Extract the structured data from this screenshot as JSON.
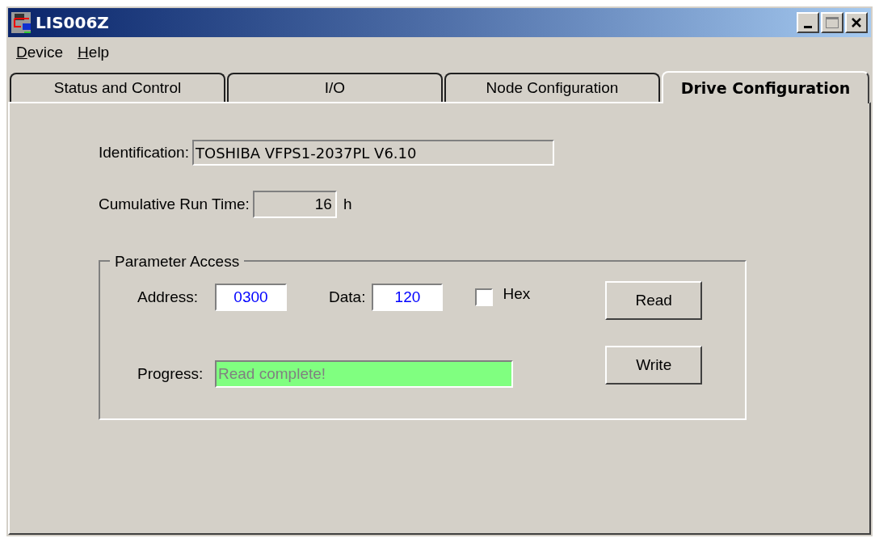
{
  "window": {
    "title": "LIS006Z"
  },
  "menu": [
    {
      "label": "Device"
    },
    {
      "label": "Help"
    }
  ],
  "tabs": [
    {
      "label": "Status and Control",
      "selected": false
    },
    {
      "label": "I/O",
      "selected": false
    },
    {
      "label": "Node Configuration",
      "selected": false
    },
    {
      "label": "Drive Configuration",
      "selected": true
    }
  ],
  "identification": {
    "label": "Identification:",
    "value": "TOSHIBA VFPS1-2037PL V6.10"
  },
  "run_time": {
    "label": "Cumulative Run Time:",
    "value": "16",
    "unit": "h"
  },
  "parameter_access": {
    "title": "Parameter Access",
    "address": {
      "label": "Address:",
      "value": "0300"
    },
    "data": {
      "label": "Data:",
      "value": "120"
    },
    "hex": {
      "label": "Hex",
      "checked": false
    },
    "buttons": [
      "Read",
      "Write"
    ],
    "progress": {
      "label": "Progress:",
      "value": "Read complete!",
      "highlighted": true
    }
  }
}
